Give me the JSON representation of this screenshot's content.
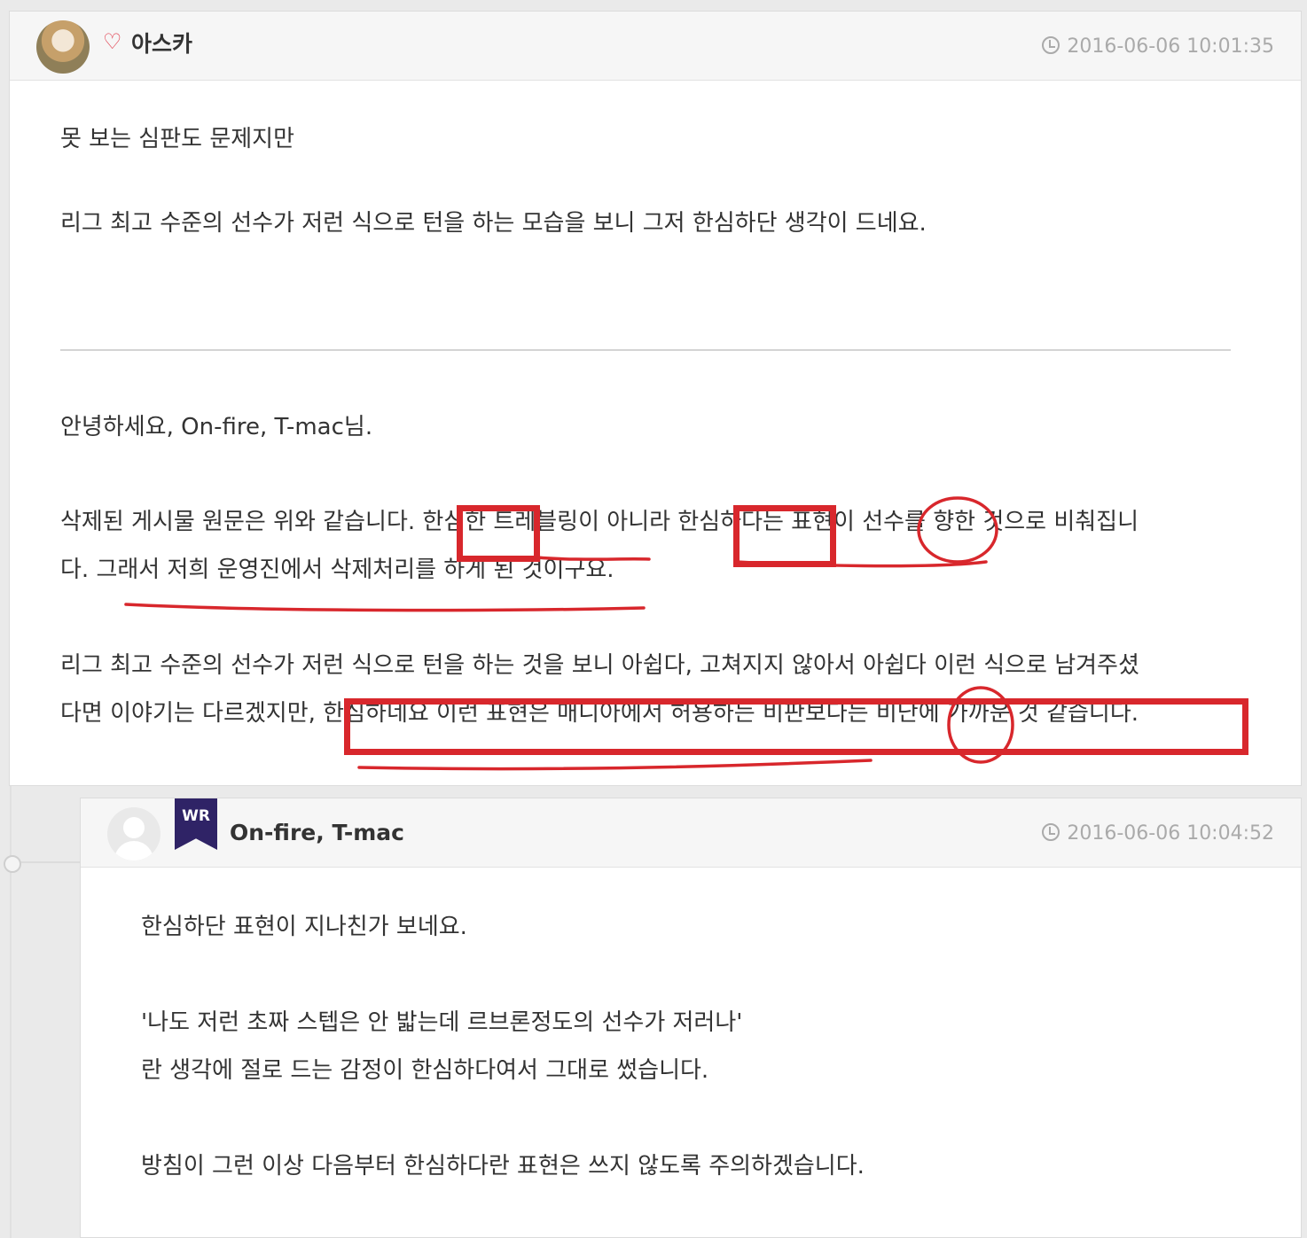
{
  "comment": {
    "author": "아스카",
    "timestamp": "2016-06-06 10:01:35",
    "icons": {
      "badge": "heart-icon",
      "time": "clock-icon"
    },
    "quoted_lines": [
      "못 보는 심판도 문제지만",
      "리그 최고 수준의 선수가 저런 식으로 턴을 하는 모습을 보니 그저 한심하단 생각이 드네요."
    ],
    "reply_lines": [
      "안녕하세요, On-fire, T-mac님.",
      "삭제된 게시물 원문은 위와 같습니다. 한심한 트레블링이 아니라 한심하다는 표현이 선수를 향한 것으로 비춰집니",
      "다. 그래서 저희 운영진에서 삭제처리를 하게 된 것이구요.",
      "리그 최고 수준의 선수가 저런 식으로 턴을 하는 것을 보니 아쉽다, 고쳐지지 않아서 아쉽다 이런 식으로 남겨주셨",
      "다면 이야기는 다르겠지만, 한심하네요 이런 표현은 매니아에서 허용하는 비판보다는 비난에 가까운 것 같습니다."
    ]
  },
  "reply": {
    "badge": "WR",
    "author": "On-fire, T-mac",
    "timestamp": "2016-06-06 10:04:52",
    "lines": [
      "한심하단 표현이 지나친가 보네요.",
      "'나도 저런 초짜 스텝은 안 밟는데 르브론정도의 선수가 저러나'",
      "란 생각에 절로 드는 감정이 한심하다여서 그대로 썼습니다.",
      "방침이 그런 이상 다음부터 한심하다란 표현은 쓰지 않도록 주의하겠습니다."
    ]
  },
  "annotation_color": "#d8272c"
}
